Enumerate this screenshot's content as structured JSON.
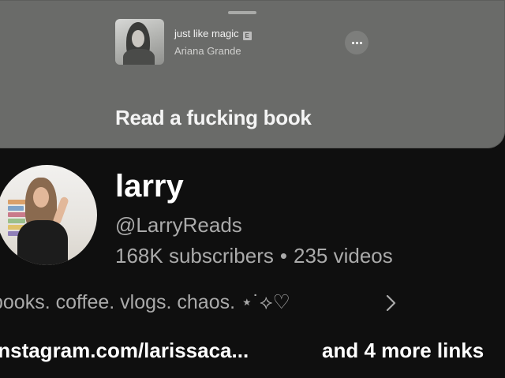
{
  "music_card": {
    "song_title": "just like magic",
    "explicit_badge": "E",
    "artist": "Ariana Grande",
    "caption": "Read a fucking book"
  },
  "channel": {
    "name": "larry",
    "handle": "@LarryReads",
    "subscribers": "168K subscribers",
    "separator": "•",
    "videos": "235 videos",
    "description": "books. coffee. vlogs. chaos. ⋆˙⟡♡",
    "link": "instagram.com/larissaca...",
    "more_links": "and 4 more links"
  },
  "icons": {
    "more": "more-horizontal-icon",
    "chevron": "chevron-right-icon"
  },
  "colors": {
    "background": "#0f0f0f",
    "card": "#6a6b69",
    "secondary_text": "#aaaaaa"
  }
}
